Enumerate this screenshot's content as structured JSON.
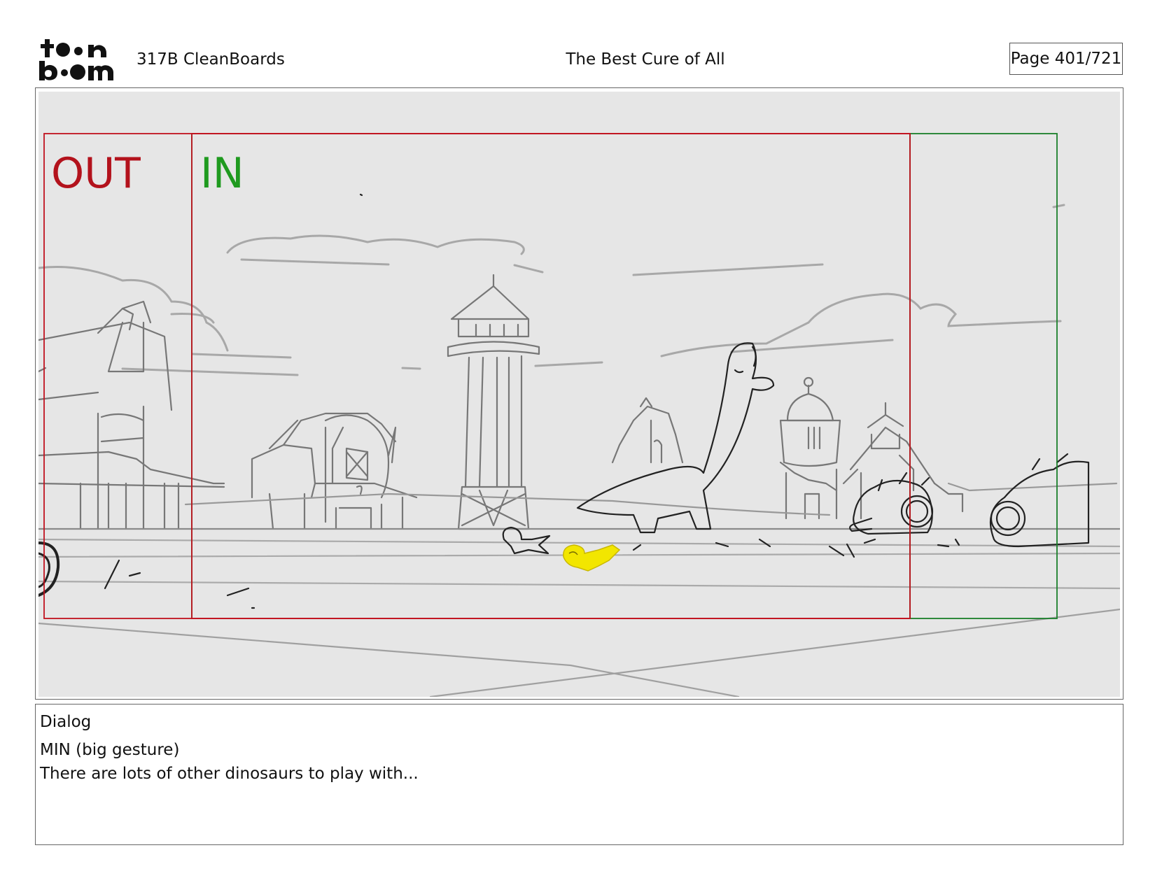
{
  "header": {
    "logo_top": "to●n",
    "logo_bottom": "b●●m",
    "episode": "317B  CleanBoards",
    "title": "The Best Cure of All",
    "page": "Page 401/721"
  },
  "panel": {
    "out_label": "OUT",
    "in_label": "IN",
    "colors": {
      "background": "#e6e6e6",
      "out_frame": "#c1121f",
      "in_frame": "#1a7f2a",
      "sketch": "#777777",
      "character": "#222222",
      "highlight": "#f2e600"
    }
  },
  "dialog": {
    "heading": "Dialog",
    "character": "MIN (big gesture)",
    "line": "There are lots of other dinosaurs to play with..."
  }
}
